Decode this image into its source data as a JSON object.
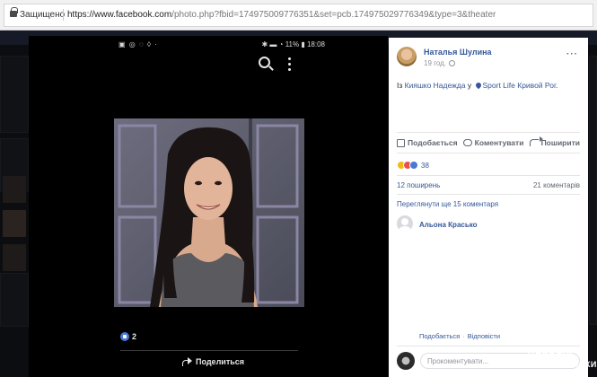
{
  "browser": {
    "secure_label": "Защищено",
    "url_host": "https://www.facebook.com",
    "url_path": "/photo.php?fbid=174975009776351&set=pcb.174975029776349&type=3&theater"
  },
  "viewer": {
    "status_time": "18:08",
    "status_battery": "11%",
    "like_count": "2",
    "share_label": "Поделиться"
  },
  "post": {
    "author": "Наталья Шулина",
    "time": "19 год.",
    "caption_prefix": "Із",
    "tagged_person": "Кияшко Надежда",
    "caption_mid": "у",
    "location": "Sport Life Кривой Рог.",
    "actions": {
      "like": "Подобається",
      "comment": "Коментувати",
      "share": "Поширити"
    },
    "reaction_count": "38",
    "shares": "12 поширень",
    "comments": "21 коментарів",
    "more_comments": "Переглянути ще 15 коментаря",
    "commenter": "Альона Красько",
    "comment_like": "Подобається",
    "comment_reply": "Відповісти",
    "comment_input_placeholder": "Прокоментувати..."
  },
  "watermark": {
    "site": "kr.ua",
    "line1": "ПЕРВЫЙ",
    "line2": "КРИВОРОЖСКИЙ"
  }
}
